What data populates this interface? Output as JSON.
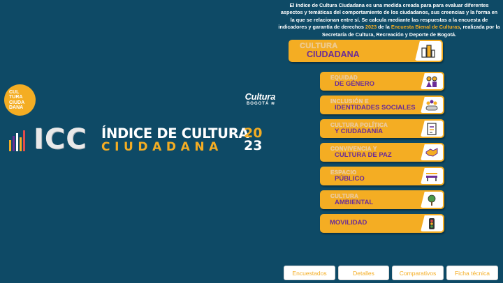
{
  "intro": {
    "part1": "El índice de Cultura Ciudadana es una medida creada para para evaluar diferentes aspectos y temáticas del comportamiento de los ciudadanos, sus creencias y la forma en la que se relacionan entre sí. Se calcula mediante las respuestas a la encuesta de indicadores y garantía de derechos ",
    "year": "2023",
    "part2": " de la ",
    "survey": "Encuesta Bienal de Culturas",
    "part3": ", realizada por la Secretaría de Cultura, Recreación y Deporte de Bogotá."
  },
  "logo_circle": {
    "line1": "CUL",
    "line2": "TURA",
    "line3": "CIUDA",
    "line4": "DANA"
  },
  "cultura_bogota": {
    "line1": "Cultura",
    "line2": "BOGOTÁ"
  },
  "hero": {
    "acronym": "ICC",
    "title_line1": "ÍNDICE DE CULTURA",
    "title_line2": "CIUDADANA",
    "year_top": "20",
    "year_bottom": "23"
  },
  "categories": {
    "main": {
      "l1": "Cultura",
      "l2": "Ciudadana",
      "icon": "city-icon"
    },
    "genero": {
      "l1": "Equidad",
      "l2": "de género",
      "icon": "gender-icon"
    },
    "identidades": {
      "l1": "Inclusión e",
      "l2": "identidades sociales",
      "icon": "people-icon"
    },
    "politica": {
      "l1": "Cultura política",
      "l2": "y ciudadanía",
      "icon": "vote-icon"
    },
    "convivencia": {
      "l1": "Convivencia y",
      "l2": "cultura de paz",
      "icon": "handshake-icon"
    },
    "espacio": {
      "l1": "Espacio",
      "l2": "público",
      "icon": "bench-icon"
    },
    "ambiental": {
      "l1": "Cultura",
      "l2": "ambiental",
      "icon": "tree-icon"
    },
    "movilidad": {
      "label": "Movilidad",
      "icon": "traffic-light-icon"
    }
  },
  "buttons": {
    "encuestados": "Encuestados",
    "detalles": "Detalles",
    "comparativos": "Comparativos",
    "ficha": "Ficha técnica"
  },
  "colors": {
    "background": "#0e4a66",
    "accent": "#f4ad23",
    "purple": "#6b2d97"
  }
}
